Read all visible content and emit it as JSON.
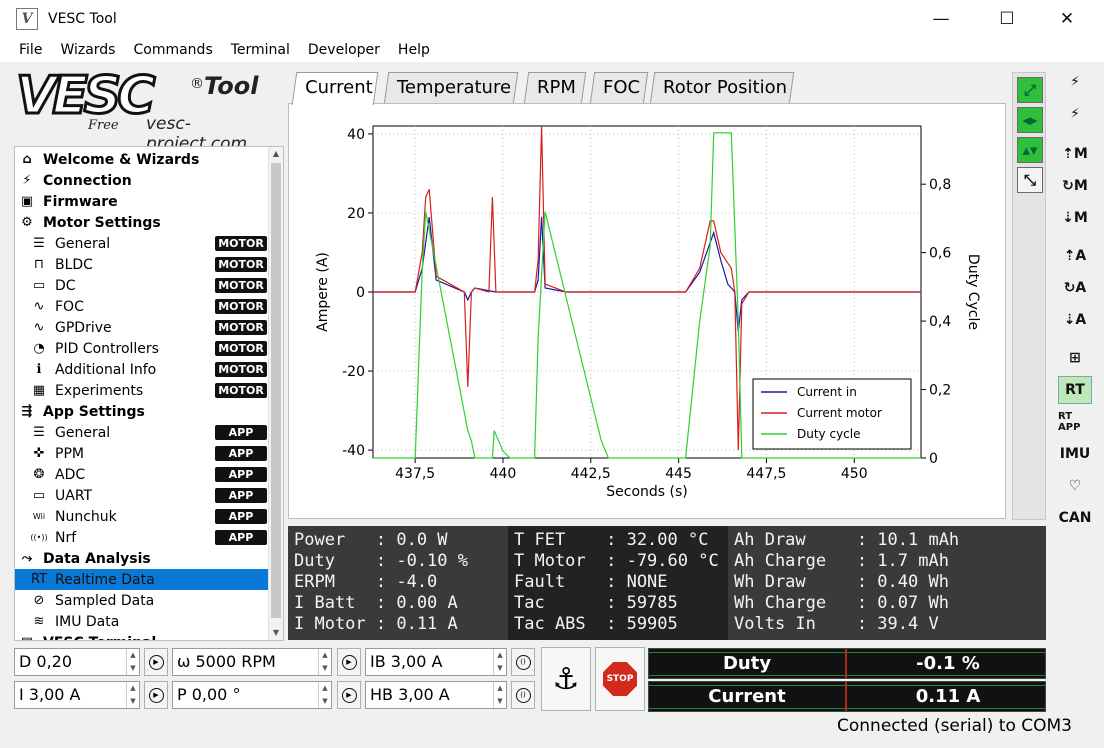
{
  "window": {
    "title": "VESC Tool",
    "minimize": "—",
    "maximize": "☐",
    "close": "✕"
  },
  "menu": [
    "File",
    "Wizards",
    "Commands",
    "Terminal",
    "Developer",
    "Help"
  ],
  "logo": {
    "main": "VESC",
    "tool": "Tool",
    "reg": "®",
    "free": "Free",
    "site": "vesc-project.com"
  },
  "tree": [
    {
      "label": "Welcome & Wizards",
      "level": 0,
      "icon": "home-icon",
      "glyph": "⌂"
    },
    {
      "label": "Connection",
      "level": 0,
      "icon": "plug-icon",
      "glyph": "⚡"
    },
    {
      "label": "Firmware",
      "level": 0,
      "icon": "chip-icon",
      "glyph": "▣"
    },
    {
      "label": "Motor Settings",
      "level": 0,
      "icon": "motor-icon",
      "glyph": "⚙"
    },
    {
      "label": "General",
      "level": 1,
      "icon": "sliders-icon",
      "glyph": "☰",
      "badge": "MOTOR"
    },
    {
      "label": "BLDC",
      "level": 1,
      "icon": "bldc-wave-icon",
      "glyph": "⊓",
      "badge": "MOTOR"
    },
    {
      "label": "DC",
      "level": 1,
      "icon": "battery-icon",
      "glyph": "▭",
      "badge": "MOTOR"
    },
    {
      "label": "FOC",
      "level": 1,
      "icon": "foc-wave-icon",
      "glyph": "∿",
      "badge": "MOTOR"
    },
    {
      "label": "GPDrive",
      "level": 1,
      "icon": "gpdrive-wave-icon",
      "glyph": "∿",
      "badge": "MOTOR"
    },
    {
      "label": "PID Controllers",
      "level": 1,
      "icon": "gauge-icon",
      "glyph": "◔",
      "badge": "MOTOR"
    },
    {
      "label": "Additional Info",
      "level": 1,
      "icon": "info-icon",
      "glyph": "ℹ",
      "badge": "MOTOR"
    },
    {
      "label": "Experiments",
      "level": 1,
      "icon": "calculator-icon",
      "glyph": "▦",
      "badge": "MOTOR"
    },
    {
      "label": "App Settings",
      "level": 0,
      "icon": "app-icon",
      "glyph": "⇶"
    },
    {
      "label": "General",
      "level": 1,
      "icon": "sliders-icon",
      "glyph": "☰",
      "badge": "APP"
    },
    {
      "label": "PPM",
      "level": 1,
      "icon": "gamepad-icon",
      "glyph": "✜",
      "badge": "APP"
    },
    {
      "label": "ADC",
      "level": 1,
      "icon": "adc-icon",
      "glyph": "❂",
      "badge": "APP"
    },
    {
      "label": "UART",
      "level": 1,
      "icon": "serial-port-icon",
      "glyph": "▭",
      "badge": "APP"
    },
    {
      "label": "Nunchuk",
      "level": 1,
      "icon": "nunchuk-icon",
      "glyph": "Wii",
      "badge": "APP"
    },
    {
      "label": "Nrf",
      "level": 1,
      "icon": "wireless-icon",
      "glyph": "((•))",
      "badge": "APP"
    },
    {
      "label": "Data Analysis",
      "level": 0,
      "icon": "chart-icon",
      "glyph": "⤳"
    },
    {
      "label": "Realtime Data",
      "level": 1,
      "icon": "realtime-icon",
      "glyph": "RT",
      "selected": true
    },
    {
      "label": "Sampled Data",
      "level": 1,
      "icon": "sampled-icon",
      "glyph": "⊘"
    },
    {
      "label": "IMU Data",
      "level": 1,
      "icon": "imu-icon",
      "glyph": "≋"
    },
    {
      "label": "VESC Terminal",
      "level": 0,
      "icon": "terminal-icon",
      "glyph": "▤"
    }
  ],
  "tabs": [
    "Current",
    "Temperature",
    "RPM",
    "FOC",
    "Rotor Position"
  ],
  "chart_data": {
    "type": "line",
    "xlabel": "Seconds (s)",
    "ylabel": "Ampere (A)",
    "y2label": "Duty Cycle",
    "xlim": [
      436.3,
      451.9
    ],
    "ylim": [
      -42,
      42
    ],
    "y2lim": [
      0,
      0.97
    ],
    "xticks": [
      "437,5",
      "440",
      "442,5",
      "445",
      "447,5",
      "450"
    ],
    "xtick_values": [
      437.5,
      440,
      442.5,
      445,
      447.5,
      450
    ],
    "yticks": [
      "40",
      "20",
      "0",
      "-20",
      "-40"
    ],
    "ytick_values": [
      40,
      20,
      0,
      -20,
      -40
    ],
    "y2ticks": [
      "0,8",
      "0,6",
      "0,4",
      "0,2",
      "0"
    ],
    "y2tick_values": [
      0.8,
      0.6,
      0.4,
      0.2,
      0
    ],
    "legend_position": "bottom-right",
    "series": [
      {
        "name": "Current in",
        "axis": "left",
        "color": "#1a1aa6",
        "x": [
          436.3,
          437.5,
          437.7,
          437.9,
          438.1,
          438.9,
          439.0,
          439.1,
          439.2,
          439.8,
          440.9,
          441.0,
          441.1,
          441.2,
          441.8,
          445.2,
          445.6,
          446.0,
          446.2,
          446.4,
          446.6,
          446.7,
          446.8,
          447.0,
          451.9
        ],
        "y": [
          0,
          0,
          6,
          19,
          3,
          0,
          -2,
          0,
          1,
          0,
          0,
          3,
          19,
          1,
          0,
          0,
          5,
          15,
          8,
          2,
          0,
          -10,
          -2,
          0,
          0
        ]
      },
      {
        "name": "Current motor",
        "axis": "left",
        "color": "#d81e1e",
        "x": [
          436.3,
          437.5,
          437.7,
          437.8,
          437.9,
          438.1,
          438.9,
          439.0,
          439.1,
          439.2,
          439.6,
          439.7,
          439.8,
          440.9,
          441.0,
          441.1,
          441.2,
          441.8,
          445.2,
          445.6,
          445.9,
          446.0,
          446.2,
          446.5,
          446.6,
          446.7,
          446.8,
          447.0,
          451.9
        ],
        "y": [
          0,
          0,
          10,
          24,
          26,
          4,
          0,
          -24,
          0,
          1,
          0,
          24,
          0,
          0,
          8,
          42,
          2,
          0,
          0,
          6,
          18,
          18,
          10,
          6,
          0,
          -40,
          -3,
          0,
          0
        ]
      },
      {
        "name": "Duty cycle",
        "axis": "right",
        "color": "#2fd12f",
        "x": [
          436.3,
          437.5,
          437.7,
          437.8,
          439.0,
          439.1,
          439.2,
          439.7,
          439.75,
          440.0,
          440.2,
          440.9,
          441.0,
          441.2,
          442.8,
          443.0,
          445.2,
          445.6,
          445.9,
          446.0,
          446.2,
          446.5,
          446.7,
          446.8,
          451.9
        ],
        "y": [
          0,
          0,
          0.55,
          0.72,
          0.08,
          0.05,
          0,
          0,
          0.08,
          0.02,
          0,
          0,
          0.35,
          0.72,
          0.05,
          0,
          0,
          0.4,
          0.62,
          0.95,
          0.95,
          0.95,
          0.4,
          0,
          0
        ]
      }
    ]
  },
  "zoombar": [
    {
      "name": "zoom-fit-icon",
      "glyph": "⤢",
      "on": true
    },
    {
      "name": "zoom-horizontal-icon",
      "glyph": "◂▸",
      "on": true
    },
    {
      "name": "zoom-vertical-icon",
      "glyph": "▴▾",
      "on": true
    },
    {
      "name": "rescale-icon",
      "glyph": "⤡",
      "on": false
    }
  ],
  "right_toolbar": [
    {
      "name": "connect-icon",
      "glyph": "⚡"
    },
    {
      "name": "disconnect-icon",
      "glyph": "⚡"
    },
    {
      "name": "read-motor-config-icon",
      "glyph": "⇡M"
    },
    {
      "name": "reset-motor-config-icon",
      "glyph": "↻M"
    },
    {
      "name": "write-motor-config-icon",
      "glyph": "⇣M"
    },
    {
      "name": "read-app-config-icon",
      "glyph": "⇡A"
    },
    {
      "name": "reset-app-config-icon",
      "glyph": "↻A"
    },
    {
      "name": "write-app-config-icon",
      "glyph": "⇣A"
    },
    {
      "name": "can-nodes-icon",
      "glyph": "⊞"
    },
    {
      "name": "realtime-stream-icon",
      "glyph": "RT",
      "on": true
    },
    {
      "name": "realtime-app-icon",
      "glyph": "RT APP"
    },
    {
      "name": "imu-stream-icon",
      "glyph": "IMU"
    },
    {
      "name": "keepalive-heart-icon",
      "glyph": "♡"
    },
    {
      "name": "can-forward-icon",
      "glyph": "CAN"
    }
  ],
  "realtime": {
    "col1": [
      "Power   : 0.0 W",
      "Duty    : -0.10 %",
      "ERPM    : -4.0",
      "I Batt  : 0.00 A",
      "I Motor : 0.11 A"
    ],
    "col2": [
      "T FET    : 32.00 °C",
      "T Motor  : -79.60 °C",
      "Fault    : NONE",
      "Tac      : 59785",
      "Tac ABS  : 59905"
    ],
    "col3": [
      "Ah Draw     : 10.1 mAh",
      "Ah Charge   : 1.7 mAh",
      "Wh Draw     : 0.40 Wh",
      "Wh Charge   : 0.07 Wh",
      "Volts In    : 39.4 V"
    ]
  },
  "controls": {
    "duty": "D 0,20",
    "rpm": "ω 5000 RPM",
    "brake_current": "IB 3,00 A",
    "current": "I 3,00 A",
    "position": "P 0,00 °",
    "handbrake": "HB 3,00 A",
    "stop_label": "STOP"
  },
  "gauges": {
    "duty_label": "Duty",
    "duty_value": "-0.1 %",
    "current_label": "Current",
    "current_value": "0.11 A"
  },
  "status": "Connected (serial) to COM3"
}
